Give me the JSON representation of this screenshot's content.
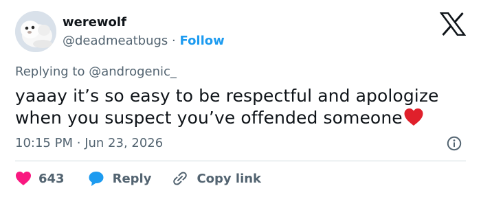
{
  "author": {
    "display_name": "werewolf",
    "handle": "@deadmeatbugs",
    "separator": "·",
    "follow_label": "Follow"
  },
  "reply_context": {
    "prefix": "Replying to",
    "mention": "@androgenic_"
  },
  "tweet": {
    "text": "yaaay it’s so easy to be respectful and apologize when you suspect you’ve offended someone",
    "emoji": "red-heart",
    "time": "10:15 PM",
    "separator": "·",
    "date": "Jun 23, 2026"
  },
  "actions": {
    "like_count": "643",
    "reply_label": "Reply",
    "copy_link_label": "Copy link"
  },
  "colors": {
    "link_blue": "#1d9bf0",
    "heart_pink": "#f91880",
    "muted_text": "#536471",
    "primary_text": "#0f1419",
    "divider": "#cfd9de",
    "emoji_red": "#e0202b"
  },
  "icons": {
    "logo": "x-logo-icon",
    "info": "info-icon",
    "like": "heart-icon",
    "reply": "speech-bubble-icon",
    "copy": "link-icon"
  }
}
